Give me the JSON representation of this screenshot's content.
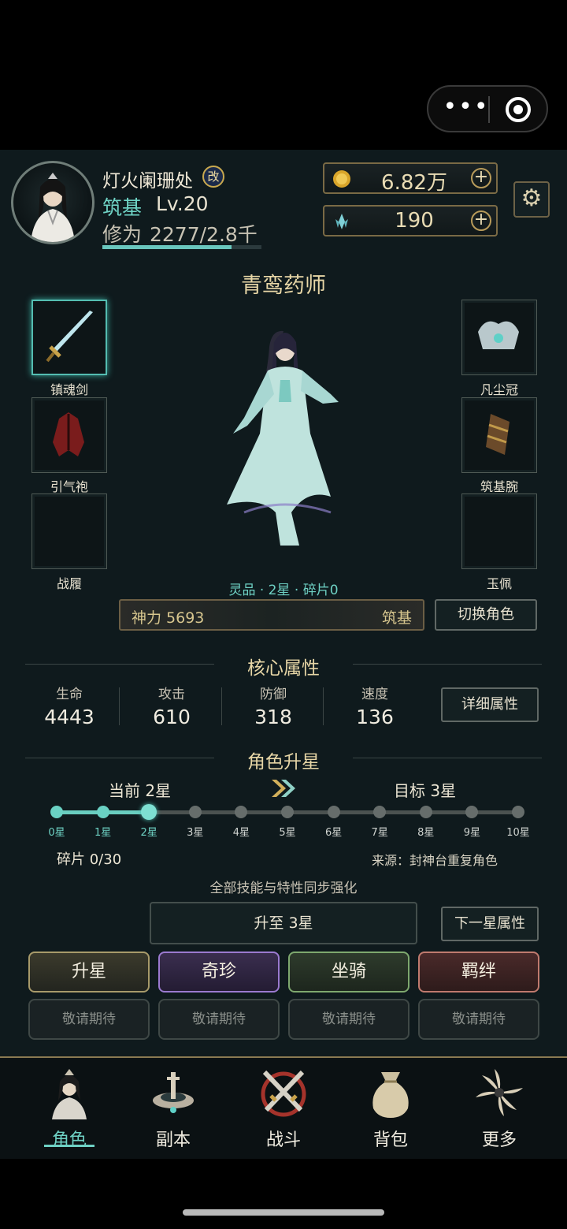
{
  "header": {
    "player_name": "灯火阑珊处",
    "rename_badge": "改",
    "realm": "筑基",
    "level": "Lv.20",
    "cultivation_label": "修为",
    "cultivation_value": "2277/2.8千",
    "cultivation_progress": 0.81,
    "gold": "6.82万",
    "crystal": "190",
    "gold_plus": "+",
    "crystal_plus": "+"
  },
  "character": {
    "title": "青鸾药师",
    "grade_line": "灵品 · 2星 · 碎片0",
    "equipment_left": [
      "镇魂剑",
      "引气袍",
      "战履"
    ],
    "equipment_right": [
      "凡尘冠",
      "筑基腕",
      "玉佩"
    ],
    "power_label": "神力 5693",
    "power_realm": "筑基",
    "switch_button": "切换角色"
  },
  "core": {
    "title": "核心属性",
    "stats": [
      {
        "label": "生命",
        "value": "4443"
      },
      {
        "label": "攻击",
        "value": "610"
      },
      {
        "label": "防御",
        "value": "318"
      },
      {
        "label": "速度",
        "value": "136"
      }
    ],
    "detail_button": "详细属性"
  },
  "upgrade": {
    "title": "角色升星",
    "current": "当前 2星",
    "target": "目标 3星",
    "stars": [
      "0星",
      "1星",
      "2星",
      "3星",
      "4星",
      "5星",
      "6星",
      "7星",
      "8星",
      "9星",
      "10星"
    ],
    "current_index": 2,
    "fragments": "碎片 0/30",
    "source": "来源：封神台重复角色",
    "note": "全部技能与特性同步强化",
    "upgrade_button": "升至 3星",
    "next_button": "下一星属性"
  },
  "features": {
    "row1": [
      "升星",
      "奇珍",
      "坐骑",
      "羁绊"
    ],
    "row2": [
      "敬请期待",
      "敬请期待",
      "敬请期待",
      "敬请期待"
    ]
  },
  "tabs": [
    "角色",
    "副本",
    "战斗",
    "背包",
    "更多"
  ],
  "colors": {
    "accent": "#6ed1c4",
    "gold": "#e7d6a6",
    "background": "#0f1a1d"
  }
}
